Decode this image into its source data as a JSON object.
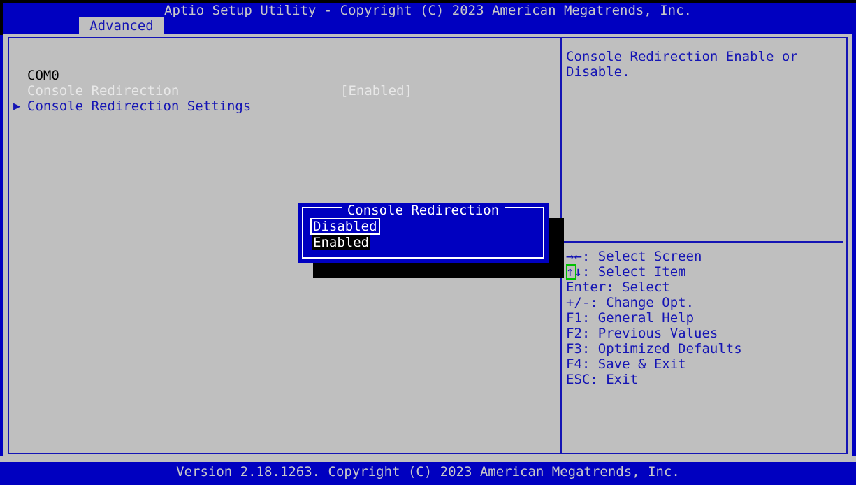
{
  "header": {
    "title": "Aptio Setup Utility - Copyright (C) 2023 American Megatrends, Inc.",
    "active_tab": "Advanced"
  },
  "tabs": [
    {
      "label": "Advanced",
      "active": true
    }
  ],
  "main": {
    "group_label": "COM0",
    "rows": [
      {
        "arrow": "",
        "label": "COM0",
        "value": "",
        "style": "group"
      },
      {
        "arrow": "",
        "label": "Console Redirection",
        "value": "[Enabled]",
        "style": "dim"
      },
      {
        "arrow": "▶",
        "label": "Console Redirection Settings",
        "value": "",
        "style": "submenu"
      }
    ]
  },
  "help": {
    "description": "Console Redirection Enable or\nDisable.",
    "keys": [
      {
        "glyph": "→←",
        "text": ": Select Screen"
      },
      {
        "glyph": "↑↓",
        "text": ": Select Item"
      },
      {
        "glyph": "",
        "text": "Enter: Select"
      },
      {
        "glyph": "",
        "text": "+/-: Change Opt."
      },
      {
        "glyph": "",
        "text": "F1: General Help"
      },
      {
        "glyph": "",
        "text": "F2: Previous Values"
      },
      {
        "glyph": "",
        "text": "F3: Optimized Defaults"
      },
      {
        "glyph": "",
        "text": "F4: Save & Exit"
      },
      {
        "glyph": "",
        "text": "ESC: Exit"
      }
    ]
  },
  "popup": {
    "title": "Console Redirection",
    "options": [
      {
        "label": "Disabled",
        "state": "cursor"
      },
      {
        "label": "Enabled",
        "state": "current"
      }
    ]
  },
  "footer": {
    "text": "Version 2.18.1263. Copyright (C) 2023 American Megatrends, Inc."
  },
  "colors": {
    "background_blue": "#0000c0",
    "panel_grey": "#bfbfbf",
    "text_blue": "#1414b4",
    "text_light": "#c8c8c8",
    "highlight_green": "#00c000",
    "white": "#ffffff",
    "black": "#000000"
  }
}
